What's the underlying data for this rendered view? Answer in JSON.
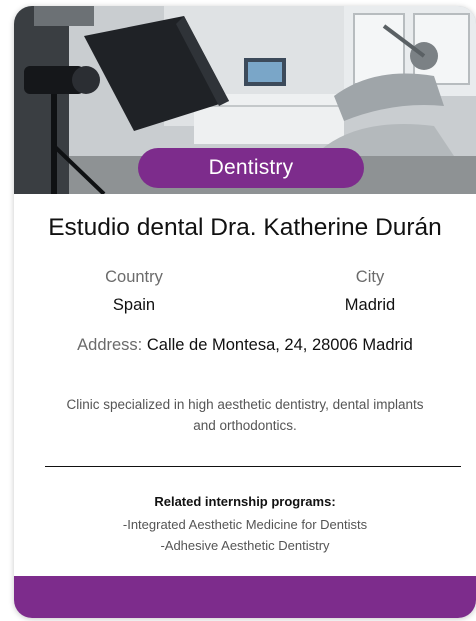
{
  "card": {
    "category": "Dentistry",
    "title": "Estudio dental Dra. Katherine Durán",
    "country_label": "Country",
    "country_value": "Spain",
    "city_label": "City",
    "city_value": "Madrid",
    "address_label": "Address:",
    "address_value": "Calle de Montesa, 24, 28006 Madrid",
    "description": "Clinic specialized in high aesthetic dentistry, dental implants and orthodontics.",
    "related_heading": "Related internship programs:",
    "related_programs": [
      "-Integrated Aesthetic Medicine for Dentists",
      "-Adhesive Aesthetic Dentistry"
    ]
  },
  "colors": {
    "accent": "#7d2c8c",
    "title_text": "#111111",
    "muted_text": "#6b6b6b"
  }
}
